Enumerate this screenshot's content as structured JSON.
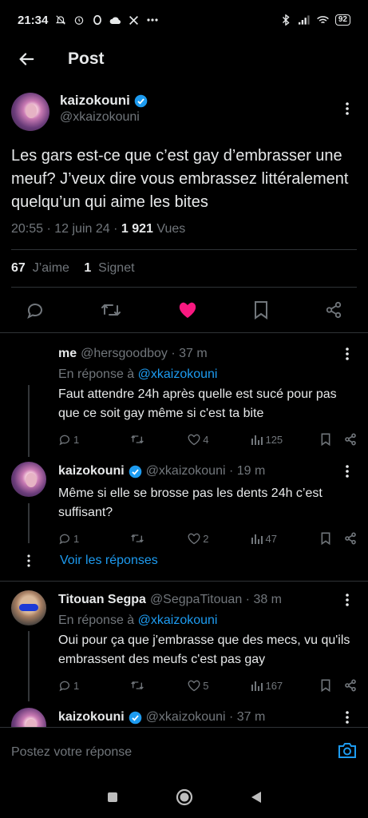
{
  "status_bar": {
    "time": "21:34",
    "battery": "92"
  },
  "header": {
    "title": "Post"
  },
  "post": {
    "name": "kaizokouni",
    "handle": "@xkaizokouni",
    "text": "Les gars est-ce que c’est gay d’embrasser une meuf? J’veux dire vous embrassez littéralement quelqu’un qui aime les bites",
    "time": "20:55 · 12 juin 24 · ",
    "views_count": "1 921",
    "views_label": " Vues",
    "likes_count": "67",
    "likes_label": "J’aime",
    "bookmarks_count": "1",
    "bookmarks_label": "Signet",
    "accent_like": "#f91880",
    "verified_color": "#1d9bf0"
  },
  "replies": [
    {
      "name": "me",
      "handle": "@hersgoodboy · 37 m",
      "reply_prefix": "En réponse à ",
      "reply_to": "@xkaizokouni",
      "text": "Faut attendre 24h après quelle est sucé pour pas que ce soit gay même si c'est ta bite",
      "comments": "1",
      "likes": "4",
      "views": "125"
    },
    {
      "name": "kaizokouni",
      "handle": "@xkaizokouni · 19 m",
      "text": "Même si elle se brosse pas les dents 24h c’est suffisant?",
      "comments": "1",
      "likes": "2",
      "views": "47"
    },
    {
      "name": "Titouan Segpa",
      "handle": "@SegpaTitouan · 38 m",
      "reply_prefix": "En réponse à ",
      "reply_to": "@xkaizokouni",
      "text": "Oui pour ça que j'embrasse que des mecs, vu qu'ils embrassent des meufs c'est pas gay",
      "comments": "1",
      "likes": "5",
      "views": "167"
    },
    {
      "name": "kaizokouni",
      "handle": "@xkaizokouni · 37 m"
    }
  ],
  "show_replies": "Voir les réponses",
  "compose": {
    "placeholder": "Postez votre réponse"
  }
}
